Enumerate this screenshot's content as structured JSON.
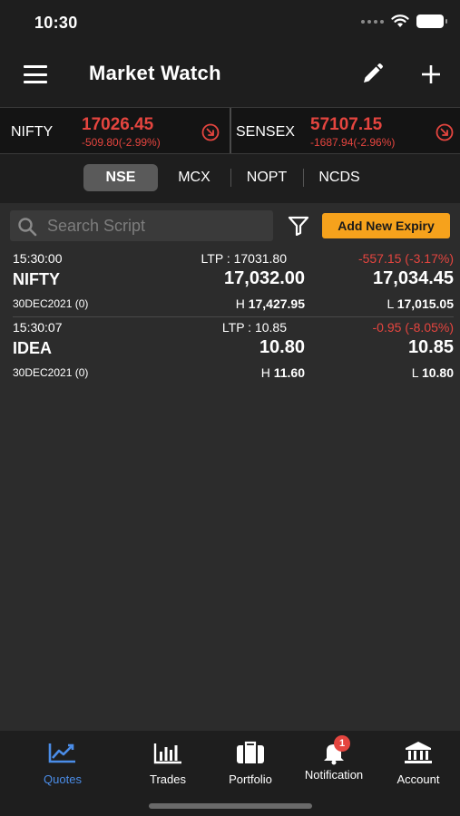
{
  "status_bar": {
    "time": "10:30"
  },
  "header": {
    "title": "Market Watch"
  },
  "tickers": [
    {
      "name": "NIFTY",
      "value": "17026.45",
      "change": "-509.80(-2.99%)"
    },
    {
      "name": "SENSEX",
      "value": "57107.15",
      "change": "-1687.94(-2.96%)"
    }
  ],
  "exchange_tabs": [
    {
      "label": "NSE",
      "active": true
    },
    {
      "label": "MCX",
      "active": false
    },
    {
      "label": "NOPT",
      "active": false
    },
    {
      "label": "NCDS",
      "active": false
    }
  ],
  "search": {
    "placeholder": "Search Script"
  },
  "add_expiry_label": "Add New Expiry",
  "quotes": [
    {
      "time": "15:30:00",
      "ltp": "LTP : 17031.80",
      "change": "-557.15 (-3.17%)",
      "symbol": "NIFTY",
      "bid": "17,032.00",
      "ask": "17,034.45",
      "expiry": "30DEC2021 (0)",
      "high_prefix": "H",
      "high": "17,427.95",
      "low_prefix": "L",
      "low": "17,015.05"
    },
    {
      "time": "15:30:07",
      "ltp": "LTP : 10.85",
      "change": "-0.95 (-8.05%)",
      "symbol": "IDEA",
      "bid": "10.80",
      "ask": "10.85",
      "expiry": "30DEC2021 (0)",
      "high_prefix": "H",
      "high": "11.60",
      "low_prefix": "L",
      "low": "10.80"
    }
  ],
  "nav": [
    {
      "label": "Quotes",
      "icon": "chart-line-icon",
      "active": true
    },
    {
      "label": "Trades",
      "icon": "bar-chart-icon",
      "active": false
    },
    {
      "label": "Portfolio",
      "icon": "briefcase-icon",
      "active": false
    },
    {
      "label": "Notification",
      "icon": "bell-icon",
      "active": false,
      "badge": "1"
    },
    {
      "label": "Account",
      "icon": "bank-icon",
      "active": false
    }
  ],
  "colors": {
    "accent": "#4b8de8",
    "negative": "#e5453f",
    "expiry_button": "#f6a21c",
    "background": "#2c2c2c",
    "header_background": "#1e1e1e"
  }
}
